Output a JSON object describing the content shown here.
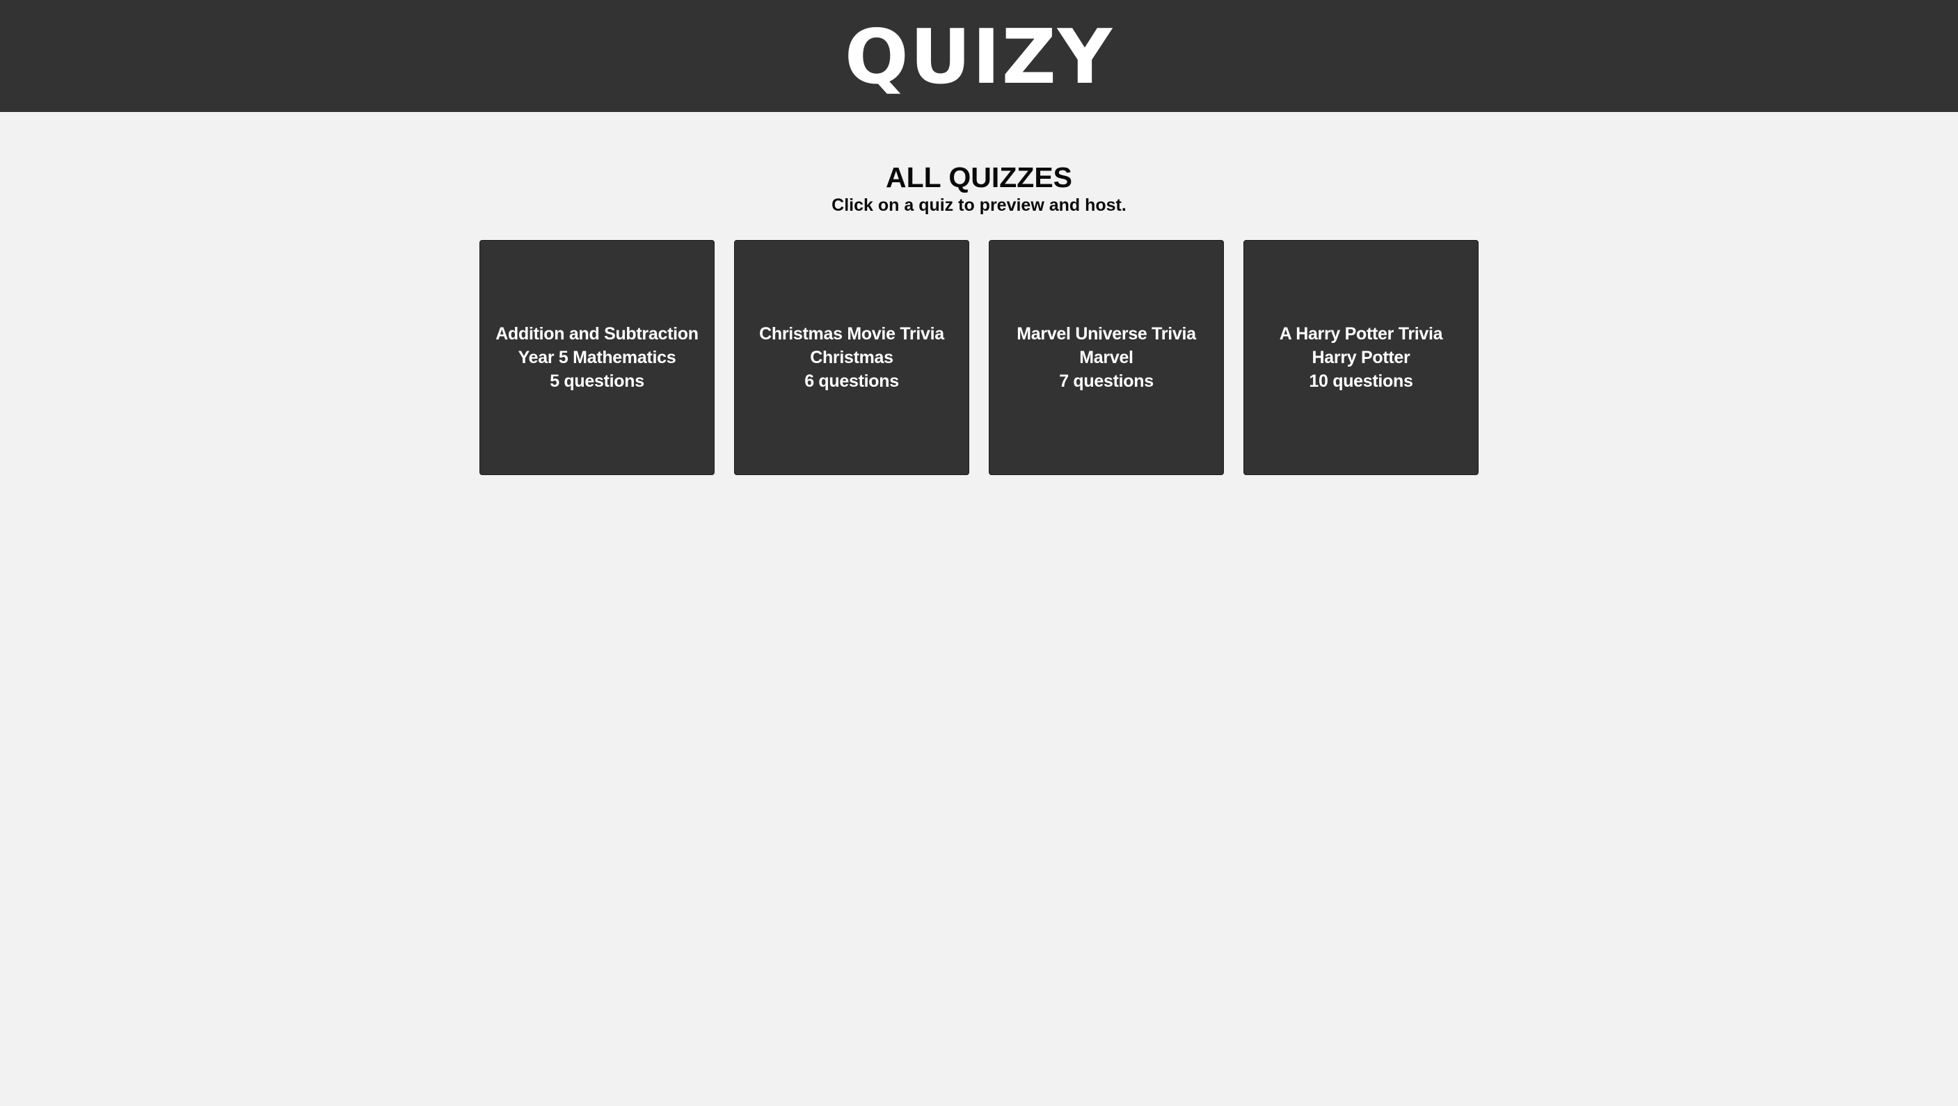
{
  "header": {
    "logo": "QUIZY"
  },
  "main": {
    "heading": "ALL QUIZZES",
    "subheading": "Click on a quiz to preview and host."
  },
  "quizzes": [
    {
      "title": "Addition and Subtraction",
      "category": "Year 5 Mathematics",
      "count": "5 questions"
    },
    {
      "title": "Christmas Movie Trivia",
      "category": "Christmas",
      "count": "6 questions"
    },
    {
      "title": "Marvel Universe Trivia",
      "category": "Marvel",
      "count": "7 questions"
    },
    {
      "title": "A Harry Potter Trivia",
      "category": "Harry Potter",
      "count": "10 questions"
    }
  ],
  "colors": {
    "header_bg": "#333333",
    "page_bg": "#f2f2f2",
    "card_bg": "#333333",
    "card_text": "#ffffff"
  }
}
